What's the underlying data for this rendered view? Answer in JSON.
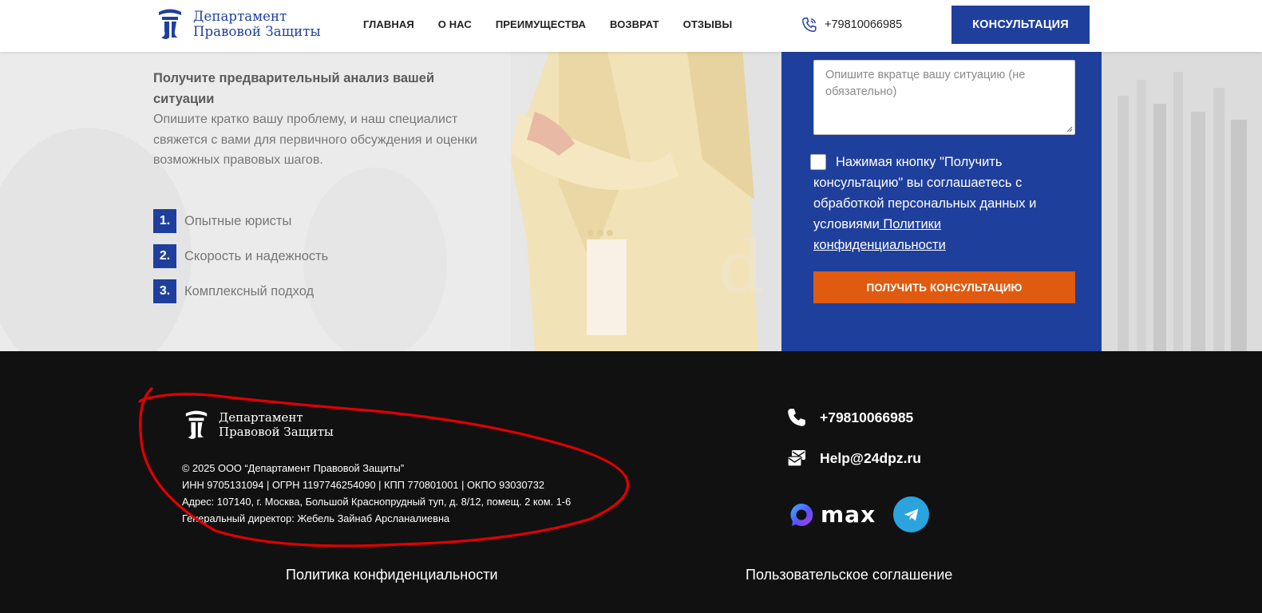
{
  "header": {
    "logo_line1": "Департамент",
    "logo_line2": "Правовой Защиты",
    "nav": [
      "ГЛАВНАЯ",
      "О НАС",
      "ПРЕИМУЩЕСТВА",
      "ВОЗВРАТ",
      "ОТЗЫВЫ"
    ],
    "phone": "+79810066985",
    "consult_button": "КОНСУЛЬТАЦИЯ"
  },
  "hero": {
    "intro_bold": "Получите предварительный анализ вашей ситуации",
    "intro_text": "Опишите кратко вашу проблему, и наш специалист свяжется с вами для  первичного обсуждения и оценки возможных правовых шагов.",
    "features": [
      {
        "num": "1.",
        "text": "Опытные юристы"
      },
      {
        "num": "2.",
        "text": "Скорость и надежность"
      },
      {
        "num": "3.",
        "text": "Комплексный подход"
      }
    ]
  },
  "form": {
    "textarea_placeholder": "Опишите вкратце вашу ситуацию (не обязательно)",
    "agree_text": "Нажимая кнопку \"Получить консультацию\" вы соглашаетесь с обработкой персональных данных и условиями",
    "agree_link": " Политики конфиденциальности",
    "submit": "ПОЛУЧИТЬ КОНСУЛЬТАЦИЮ"
  },
  "footer": {
    "logo_line1": "Департамент",
    "logo_line2": "Правовой Защиты",
    "copyright": "© 2025 ООО “Департамент Правовой Защиты”",
    "registry": "ИНН 9705131094 | ОГРН 1197746254090 | КПП 770801001 | ОКПО 93030732",
    "address": "Адрес: 107140, г. Москва, Большой Краснопрудный туп, д. 8/12, помещ. 2 ком. 1-6",
    "director": "Генеральный директор: Жебель Зайнаб Арсланалиевна",
    "phone": "+79810066985",
    "email": "Help@24dpz.ru",
    "max_label": "max",
    "privacy_link": "Политика конфиденциальности",
    "terms_link": "Пользовательское соглашение"
  },
  "colors": {
    "brand_blue": "#1f3f9c",
    "accent_orange": "#e05a0f",
    "footer_bg": "#111111",
    "annotation_red": "#e00000",
    "telegram": "#2aa3df"
  }
}
